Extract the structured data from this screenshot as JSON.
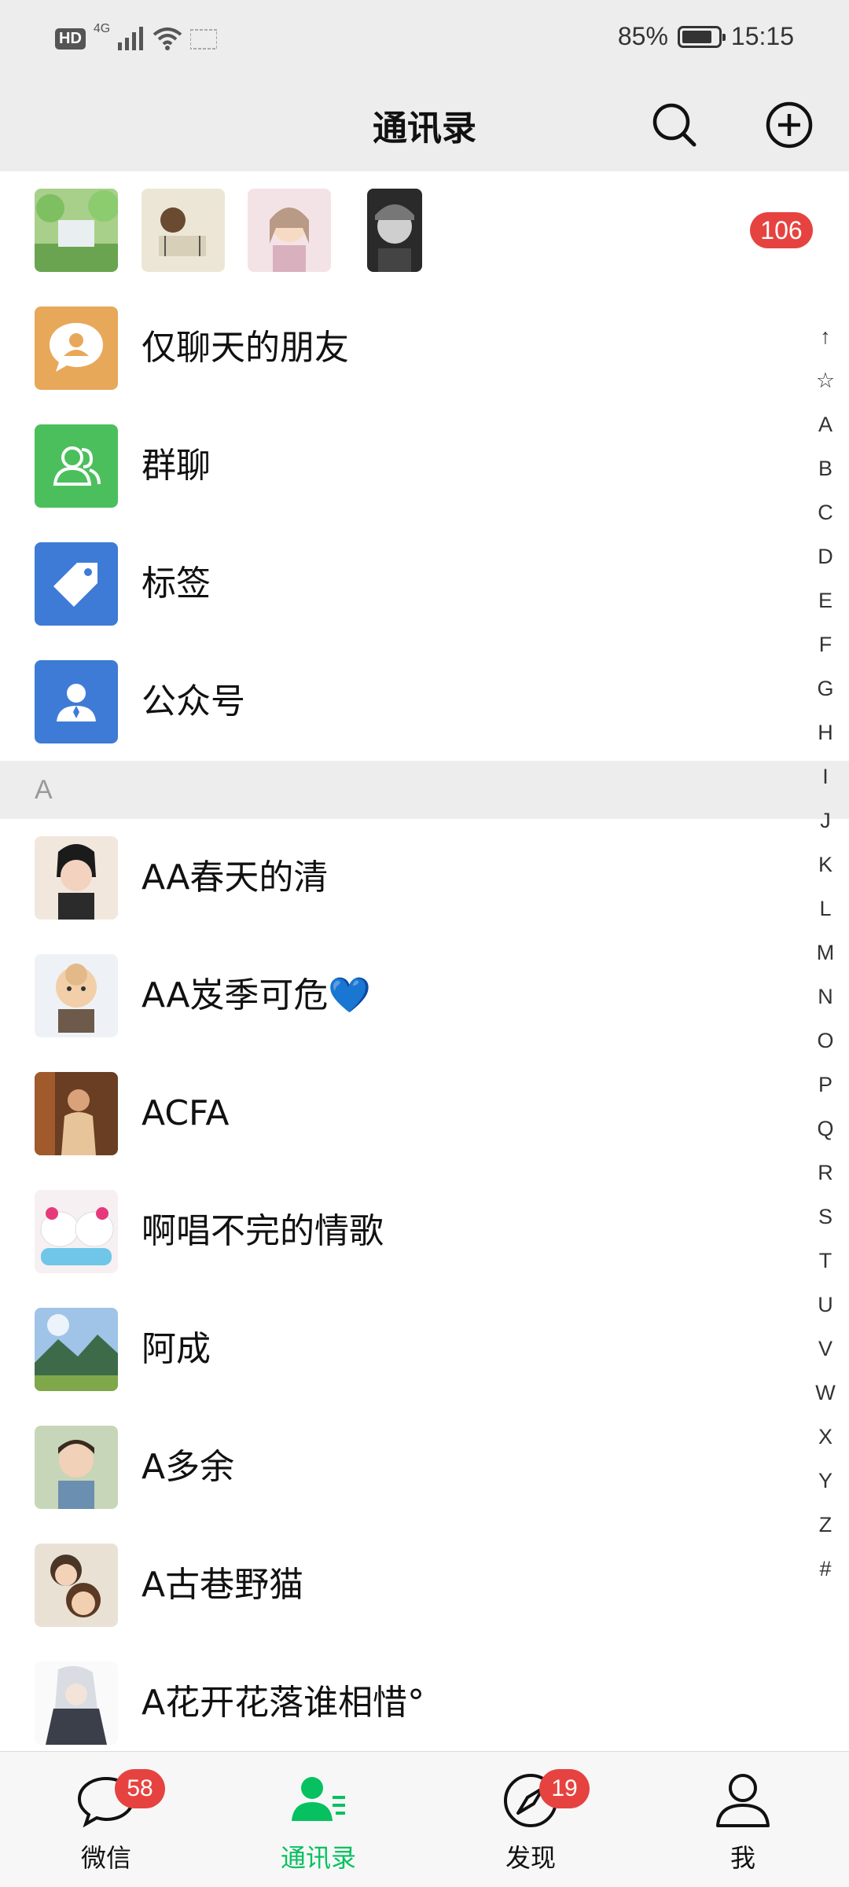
{
  "status_bar": {
    "hd": "HD",
    "network": "4G",
    "battery_percent": "85%",
    "battery_level": 0.85,
    "time": "15:15"
  },
  "header": {
    "title": "通讯录",
    "search_icon": "search-icon",
    "add_icon": "add-circle-icon"
  },
  "recommend": {
    "badge": "106"
  },
  "functions": [
    {
      "label": "仅聊天的朋友",
      "icon": "chat-friend-icon",
      "color": "#e8a85a"
    },
    {
      "label": "群聊",
      "icon": "group-chat-icon",
      "color": "#4cbf5d"
    },
    {
      "label": "标签",
      "icon": "tag-icon",
      "color": "#3e7bd6"
    },
    {
      "label": "公众号",
      "icon": "official-account-icon",
      "color": "#3e7bd6"
    }
  ],
  "section": {
    "letter": "A"
  },
  "contacts": [
    {
      "name": "AA春天的清"
    },
    {
      "name": "AA岌季可危💙"
    },
    {
      "name": "ACFA"
    },
    {
      "name": "啊唱不完的情歌"
    },
    {
      "name": "阿成"
    },
    {
      "name": "A多余"
    },
    {
      "name": "A古巷野猫"
    },
    {
      "name": "A花开花落谁相惜°"
    }
  ],
  "index_bar": [
    "↑",
    "☆",
    "A",
    "B",
    "C",
    "D",
    "E",
    "F",
    "G",
    "H",
    "I",
    "J",
    "K",
    "L",
    "M",
    "N",
    "O",
    "P",
    "Q",
    "R",
    "S",
    "T",
    "U",
    "V",
    "W",
    "X",
    "Y",
    "Z",
    "#"
  ],
  "nav": {
    "chats": {
      "label": "微信",
      "badge": "58",
      "icon": "chat-bubble-icon"
    },
    "contacts": {
      "label": "通讯录",
      "icon": "contacts-icon",
      "active": true
    },
    "discover": {
      "label": "发现",
      "badge": "19",
      "icon": "compass-icon"
    },
    "me": {
      "label": "我",
      "icon": "person-icon"
    }
  },
  "colors": {
    "accent": "#07c160",
    "badge": "#e64340",
    "header_bg": "#ededed"
  }
}
